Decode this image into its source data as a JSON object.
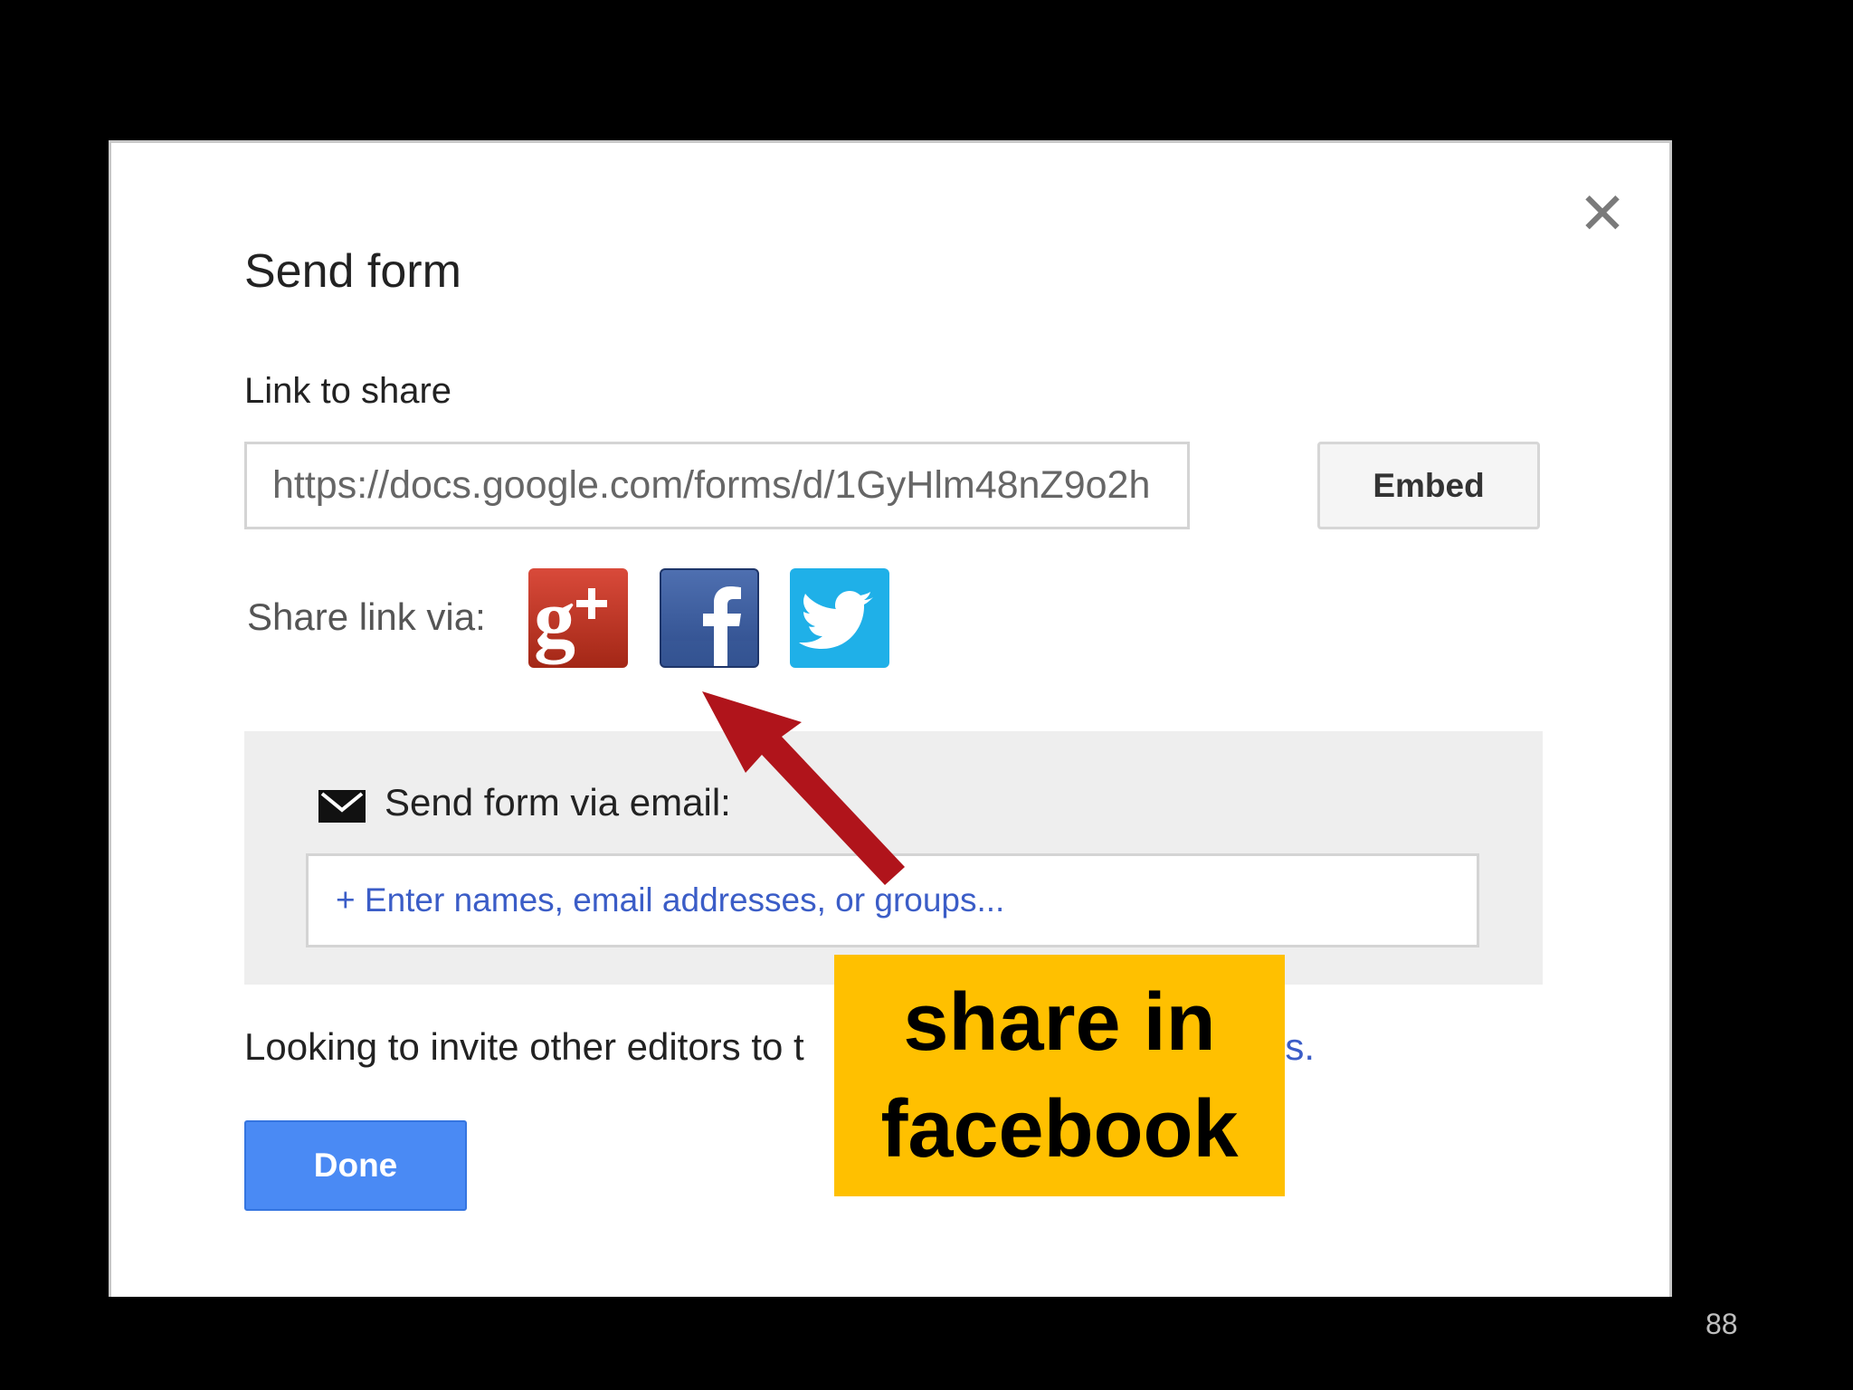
{
  "dialog": {
    "title": "Send form",
    "close_glyph": "✕",
    "link_label": "Link to share",
    "link_value": "https://docs.google.com/forms/d/1GyHlm48nZ9o2h",
    "embed_label": "Embed",
    "share_via_label": "Share link via:",
    "social_icons": [
      "google-plus-icon",
      "facebook-icon",
      "twitter-icon"
    ],
    "email_section_label": "Send form via email:",
    "email_placeholder": "+ Enter names, email addresses, or groups...",
    "invite_text": "Looking to invite other editors to t",
    "invite_link_tail": "ors.",
    "done_label": "Done"
  },
  "annotation": {
    "callout_line1": "share in",
    "callout_line2": "facebook",
    "arrow_color": "#b0141b",
    "callout_color": "#ffc000"
  },
  "slide": {
    "page_number": "88"
  }
}
